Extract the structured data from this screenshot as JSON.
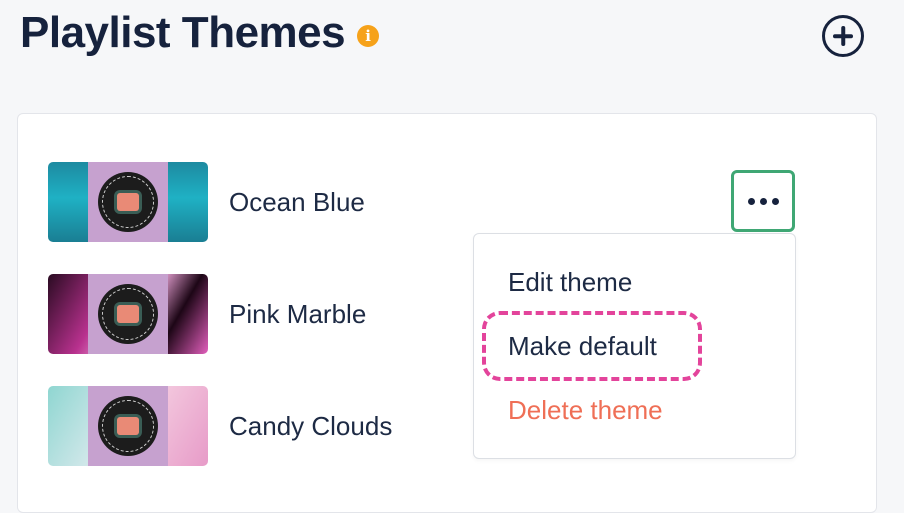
{
  "header": {
    "title": "Playlist Themes",
    "info_glyph": "i"
  },
  "themes": [
    {
      "name": "Ocean Blue"
    },
    {
      "name": "Pink Marble"
    },
    {
      "name": "Candy Clouds"
    }
  ],
  "menu": {
    "edit_label": "Edit theme",
    "default_label": "Make default",
    "delete_label": "Delete theme"
  },
  "colors": {
    "title": "#16223d",
    "info_badge": "#f6a21a",
    "more_button_border": "#3fa774",
    "delete_text": "#ef6f56",
    "highlight_dashes": "#e3449b"
  },
  "icons": {
    "info": "info-icon",
    "add": "plus-circle-icon",
    "more": "ellipsis-icon"
  }
}
